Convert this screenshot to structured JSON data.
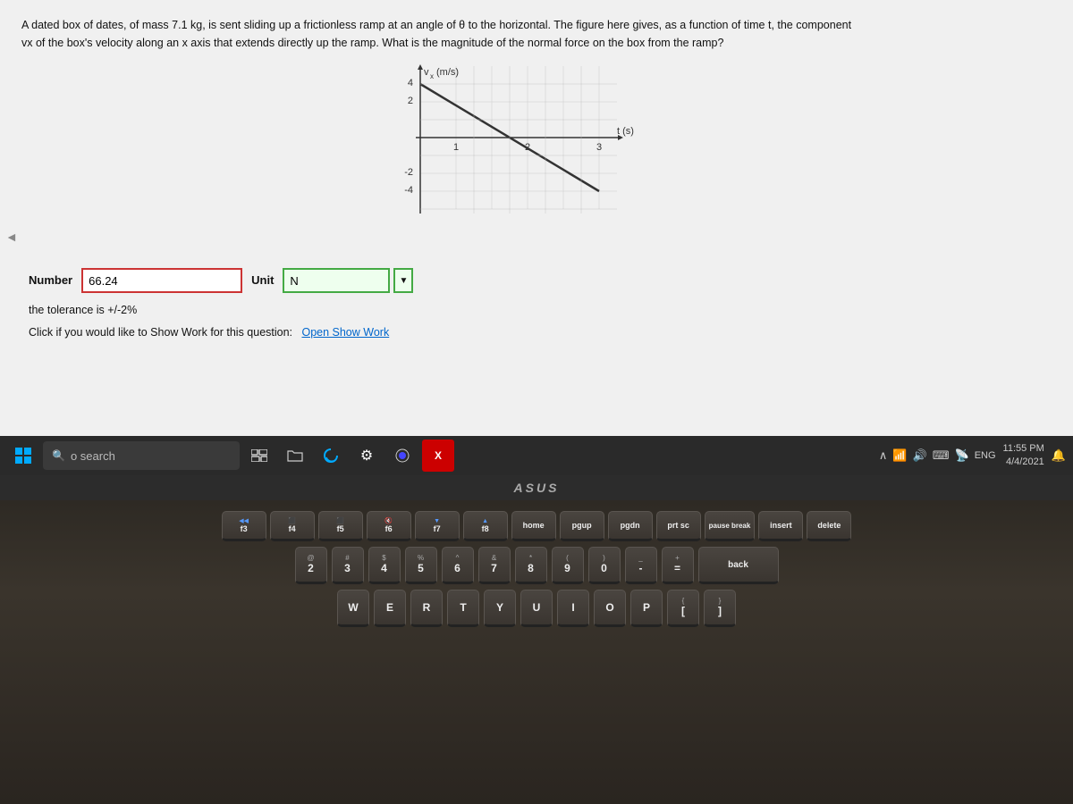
{
  "screen": {
    "problem": {
      "line1": "A dated box of dates, of mass 7.1 kg, is sent sliding up a frictionless ramp at an angle of θ to the horizontal. The figure here gives, as a function of time t, the component",
      "line2": "vx of the box's velocity along an x axis that extends directly up the ramp. What is the magnitude of the normal force on the box from the ramp?"
    },
    "graph": {
      "title": "vx (m/s)",
      "x_axis_label": "t (s)",
      "x_values": [
        0,
        1,
        2,
        3
      ],
      "y_values": [
        -4,
        -2,
        0,
        2,
        4
      ],
      "line_start": {
        "x": 0,
        "y": 4
      },
      "line_end": {
        "x": 3,
        "y": -4
      }
    },
    "answer": {
      "number_label": "Number",
      "number_value": "66.24",
      "unit_label": "Unit",
      "unit_value": "N"
    },
    "tolerance": "the tolerance is +/-2%",
    "show_work": {
      "prefix": "Click if you would like to Show Work for this question:",
      "link": "Open Show Work"
    }
  },
  "taskbar": {
    "search_placeholder": "o search",
    "time": "11:55 PM",
    "date": "4/4/2021",
    "language": "ENG"
  },
  "laptop": {
    "brand": "ASUS"
  },
  "keyboard": {
    "fn_row": [
      {
        "label": "f3",
        "fn": ""
      },
      {
        "label": "f4",
        "fn": ""
      },
      {
        "label": "f5",
        "fn": ""
      },
      {
        "label": "f6",
        "fn": ""
      },
      {
        "label": "f7",
        "fn": ""
      },
      {
        "label": "f8",
        "fn": ""
      },
      {
        "label": "home",
        "fn": ""
      },
      {
        "label": "pgup",
        "fn": ""
      },
      {
        "label": "pgdn",
        "fn": ""
      },
      {
        "label": "prt sc",
        "fn": ""
      },
      {
        "label": "pause break",
        "fn": ""
      },
      {
        "label": "insert",
        "fn": ""
      },
      {
        "label": "delete",
        "fn": ""
      }
    ],
    "row1": [
      "2",
      "3",
      "4",
      "5",
      "6",
      "7",
      "8",
      "9",
      "0",
      "-",
      "=",
      "back"
    ],
    "row2": [
      "W",
      "E",
      "R",
      "T",
      "Y",
      "U",
      "I",
      "O",
      "P",
      "[",
      "]"
    ]
  }
}
